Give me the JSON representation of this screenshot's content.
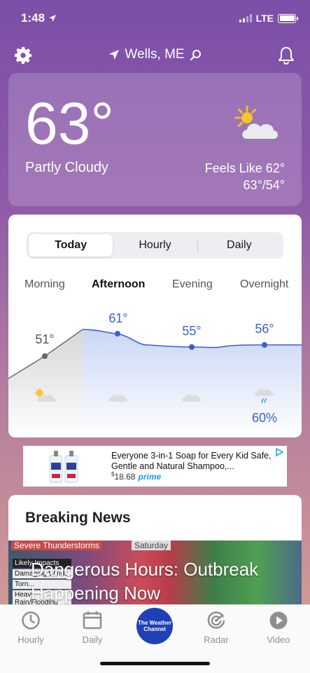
{
  "status_bar": {
    "time": "1:48",
    "network": "LTE"
  },
  "header": {
    "location": "Wells, ME"
  },
  "current": {
    "temperature": "63°",
    "condition": "Partly Cloudy",
    "feels_like": "Feels Like 62°",
    "hi_lo": "63°/54°"
  },
  "forecast": {
    "tabs": [
      "Today",
      "Hourly",
      "Daily"
    ],
    "active_tab": "Today",
    "periods": [
      {
        "label": "Morning",
        "temp": "51°",
        "icon": "partly-cloudy-icon",
        "precip": ""
      },
      {
        "label": "Afternoon",
        "temp": "61°",
        "icon": "cloud-icon",
        "precip": ""
      },
      {
        "label": "Evening",
        "temp": "55°",
        "icon": "cloud-icon",
        "precip": ""
      },
      {
        "label": "Overnight",
        "temp": "56°",
        "icon": "rain-cloud-icon",
        "precip": "60%"
      }
    ],
    "active_period": "Afternoon"
  },
  "ad": {
    "title": "Everyone 3-in-1 Soap for Every Kid Safe, Gentle and Natural Shampoo,...",
    "price": "18.68",
    "price_currency": "$",
    "badge": "prime"
  },
  "news": {
    "section_title": "Breaking News",
    "headline": "Dangerous Hours: Outbreak Happening Now",
    "image_banner": "Severe Thunderstorms",
    "image_day": "Saturday",
    "image_legend": [
      "Likely Impacts",
      "Damaging Winds",
      "Torn...",
      "Heavy Rain/Flooding"
    ]
  },
  "tab_bar": {
    "items": [
      "Hourly",
      "Daily",
      "The Weather Channel",
      "Radar",
      "Video"
    ]
  },
  "colors": {
    "accent": "#3a5fd0",
    "brand": "#1e40b8"
  }
}
